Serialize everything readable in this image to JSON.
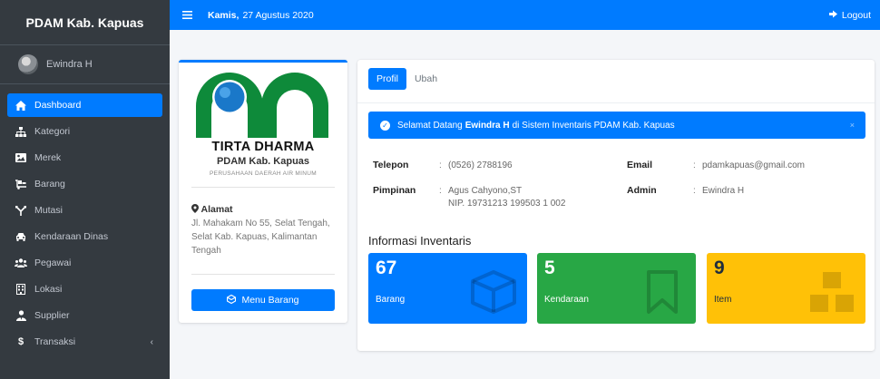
{
  "sidebar": {
    "brand": "PDAM Kab. Kapuas",
    "user_name": "Ewindra H",
    "items": [
      {
        "label": "Dashboard",
        "icon": "home-icon"
      },
      {
        "label": "Kategori",
        "icon": "sitemap-icon"
      },
      {
        "label": "Merek",
        "icon": "image-icon"
      },
      {
        "label": "Barang",
        "icon": "dolly-icon"
      },
      {
        "label": "Mutasi",
        "icon": "route-icon"
      },
      {
        "label": "Kendaraan Dinas",
        "icon": "car-icon"
      },
      {
        "label": "Pegawai",
        "icon": "users-icon"
      },
      {
        "label": "Lokasi",
        "icon": "building-icon"
      },
      {
        "label": "Supplier",
        "icon": "user-tie-icon"
      },
      {
        "label": "Transaksi",
        "icon": "dollar-icon"
      }
    ]
  },
  "topbar": {
    "date_day": "Kamis,",
    "date_rest": "27 Agustus 2020",
    "logout_label": "Logout"
  },
  "profile": {
    "logo_title": "TIRTA DHARMA",
    "logo_sub": "PDAM Kab. Kapuas",
    "logo_tag": "PERUSAHAAN DAERAH AIR MINUM",
    "address_label": "Alamat",
    "address": "Jl. Mahakam No 55, Selat Tengah, Selat Kab. Kapuas, Kalimantan Tengah",
    "menu_button": "Menu Barang"
  },
  "main": {
    "tabs": [
      {
        "label": "Profil"
      },
      {
        "label": "Ubah"
      }
    ],
    "alert": {
      "prefix": "Selamat Datang",
      "name": "Ewindra H",
      "suffix": "di Sistem Inventaris PDAM Kab. Kapuas"
    },
    "info": {
      "telepon_label": "Telepon",
      "telepon": "(0526) 2788196",
      "pimpinan_label": "Pimpinan",
      "pimpinan": "Agus Cahyono,ST",
      "pimpinan_nip": "NIP. 19731213 199503 1 002",
      "email_label": "Email",
      "email": "pdamkapuas@gmail.com",
      "admin_label": "Admin",
      "admin": "Ewindra H",
      "colon": ":"
    },
    "section_title": "Informasi Inventaris",
    "boxes": [
      {
        "value": "67",
        "label": "Barang",
        "icon": "box-icon",
        "color": "#007bff"
      },
      {
        "value": "5",
        "label": "Kendaraan",
        "icon": "bookmark-icon",
        "color": "#28a745"
      },
      {
        "value": "9",
        "label": "Item",
        "icon": "cubes-icon",
        "color": "#ffc107"
      }
    ]
  },
  "colors": {
    "sidebar_bg": "#343a40",
    "primary": "#007bff",
    "success": "#28a745",
    "warning": "#ffc107",
    "logo_green": "#0e8a3a"
  }
}
